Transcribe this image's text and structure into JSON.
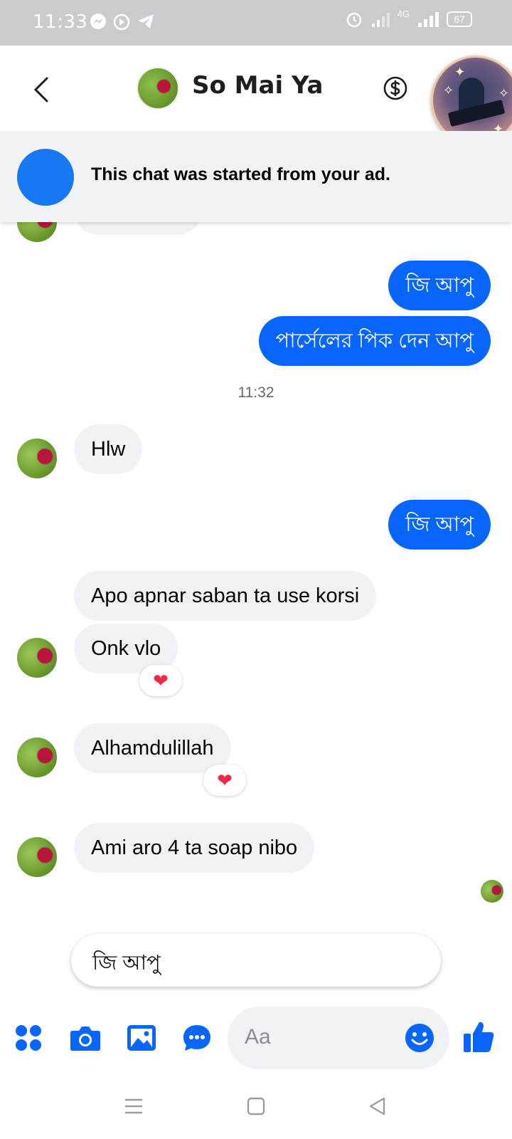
{
  "status_bar": {
    "time": "11:33",
    "network": "4G",
    "battery": "67"
  },
  "header": {
    "contact_name": "So Mai Ya"
  },
  "ad_banner": {
    "text": "This chat was started from your ad."
  },
  "messages": [
    {
      "from": "me",
      "text": "জি আপু"
    },
    {
      "from": "me",
      "text": "পার্সেলের পিক দেন আপু"
    },
    {
      "type": "timestamp",
      "text": "11:32"
    },
    {
      "from": "them",
      "text": "Hlw"
    },
    {
      "from": "me",
      "text": "জি আপু"
    },
    {
      "from": "them",
      "text": "Apo apnar saban ta use korsi"
    },
    {
      "from": "them",
      "text": "Onk vlo",
      "reaction": "❤"
    },
    {
      "from": "them",
      "text": "Alhamdulillah",
      "reaction": "❤"
    },
    {
      "from": "them",
      "text": "Ami aro 4 ta soap nibo"
    }
  ],
  "quick_reply": "জি আপু",
  "composer": {
    "placeholder": "Aa"
  },
  "colors": {
    "accent": "#0866ff",
    "incoming_bubble": "#f0f2f5",
    "status_bar": "#c9cbcf",
    "reaction": "#f02849"
  }
}
